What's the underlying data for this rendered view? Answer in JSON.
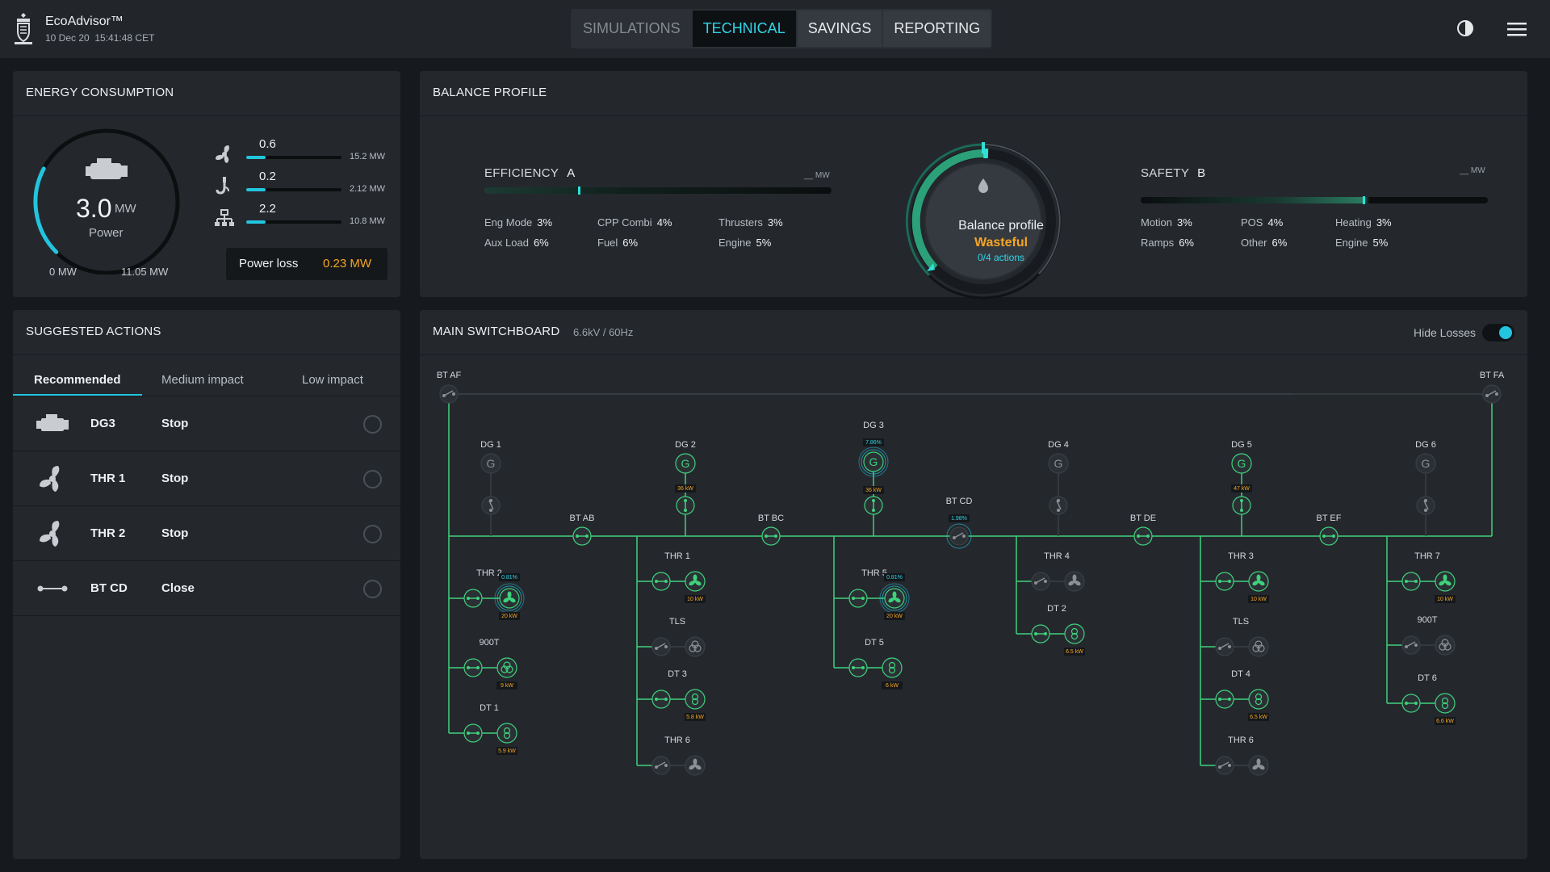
{
  "header": {
    "brand": "EcoAdvisor™",
    "date": "10 Dec 20",
    "time": "15:41:48 CET",
    "tabs": [
      "SIMULATIONS",
      "TECHNICAL",
      "SAVINGS",
      "REPORTING"
    ],
    "active_tab": "TECHNICAL"
  },
  "energy": {
    "title": "ENERGY CONSUMPTION",
    "power_value": "3.0",
    "power_unit": "MW",
    "power_label": "Power",
    "min_label": "0 MW",
    "max_label": "11.05 MW",
    "power_fraction": 0.27,
    "rows": [
      {
        "icon": "propeller-icon",
        "value": "0.6",
        "max": "15.2 MW",
        "fraction": 0.2
      },
      {
        "icon": "crane-hook-icon",
        "value": "0.2",
        "max": "2.12 MW",
        "fraction": 0.2
      },
      {
        "icon": "network-icon",
        "value": "2.2",
        "max": "10.8 MW",
        "fraction": 0.2
      }
    ],
    "power_loss_label": "Power loss",
    "power_loss_value": "0.23 MW"
  },
  "balance": {
    "title": "BALANCE PROFILE",
    "efficiency": {
      "label": "EFFICIENCY",
      "grade": "A",
      "unit": "__ MW",
      "level": 0.27,
      "items": [
        {
          "name": "Eng Mode",
          "value": "3%"
        },
        {
          "name": "CPP Combi",
          "value": "4%"
        },
        {
          "name": "Thrusters",
          "value": "3%"
        },
        {
          "name": "Aux Load",
          "value": "6%"
        },
        {
          "name": "Fuel",
          "value": "6%"
        },
        {
          "name": "Engine",
          "value": "5%"
        }
      ]
    },
    "safety": {
      "label": "SAFETY",
      "grade": "B",
      "unit": "__ MW",
      "level": 0.64,
      "items": [
        {
          "name": "Motion",
          "value": "3%"
        },
        {
          "name": "POS",
          "value": "4%"
        },
        {
          "name": "Heating",
          "value": "3%"
        },
        {
          "name": "Ramps",
          "value": "6%"
        },
        {
          "name": "Other",
          "value": "6%"
        },
        {
          "name": "Engine",
          "value": "5%"
        }
      ]
    },
    "center_title": "Balance profile",
    "center_status": "Wasteful",
    "center_actions": "0/4 actions"
  },
  "actions": {
    "title": "SUGGESTED ACTIONS",
    "tabs": [
      "Recommended",
      "Medium impact",
      "Low impact"
    ],
    "active_tab": "Recommended",
    "items": [
      {
        "icon": "engine-icon",
        "name": "DG3",
        "action": "Stop"
      },
      {
        "icon": "propeller-icon",
        "name": "THR 1",
        "action": "Stop"
      },
      {
        "icon": "propeller-icon",
        "name": "THR 2",
        "action": "Stop"
      },
      {
        "icon": "breaker-icon",
        "name": "BT CD",
        "action": "Close"
      }
    ]
  },
  "switchboard": {
    "title": "MAIN SWITCHBOARD",
    "subtitle": "6.6kV / 60Hz",
    "hide_losses_label": "Hide Losses",
    "hide_losses_on": true,
    "accent": "#3fd17c",
    "off_color": "#8a9096",
    "bus_ties": [
      {
        "name": "BT AF"
      },
      {
        "name": "BT FA"
      },
      {
        "name": "BT AB"
      },
      {
        "name": "BT BC"
      },
      {
        "name": "BT CD",
        "tag": "1.98%"
      },
      {
        "name": "BT DE"
      },
      {
        "name": "BT EF"
      }
    ],
    "generators": [
      {
        "name": "DG 1",
        "on": false
      },
      {
        "name": "DG 2",
        "on": true,
        "load": "36 kW"
      },
      {
        "name": "DG 3",
        "on": true,
        "tag": "7.86%",
        "load": "36 kW"
      },
      {
        "name": "DG 4",
        "on": false
      },
      {
        "name": "DG 5",
        "on": true,
        "load": "47 kW"
      },
      {
        "name": "DG 6",
        "on": false
      }
    ],
    "consumers": [
      {
        "name": "THR 2",
        "type": "thruster",
        "on": true,
        "tag": "0.81%",
        "load": "20 kW"
      },
      {
        "name": "900T",
        "type": "pump",
        "on": true,
        "load": "9 kW"
      },
      {
        "name": "DT 1",
        "type": "transformer",
        "on": true,
        "load": "5.9 kW"
      },
      {
        "name": "THR 1",
        "type": "thruster",
        "on": true,
        "load": "10 kW"
      },
      {
        "name": "TLS",
        "type": "pump",
        "on": false
      },
      {
        "name": "DT 3",
        "type": "transformer",
        "on": true,
        "load": "5.8 kW"
      },
      {
        "name": "THR 6",
        "type": "thruster",
        "on": false
      },
      {
        "name": "THR 5",
        "type": "thruster",
        "on": true,
        "tag": "0.81%",
        "load": "20 kW"
      },
      {
        "name": "DT 5",
        "type": "transformer",
        "on": true,
        "load": "6 kW"
      },
      {
        "name": "THR 4",
        "type": "thruster",
        "on": false
      },
      {
        "name": "DT 2",
        "type": "transformer",
        "on": true,
        "load": "6.5 kW"
      },
      {
        "name": "THR 3",
        "type": "thruster",
        "on": true,
        "load": "10 kW"
      },
      {
        "name": "TLS",
        "type": "pump",
        "on": false
      },
      {
        "name": "DT 4",
        "type": "transformer",
        "on": true,
        "load": "6.5 kW"
      },
      {
        "name": "THR 6",
        "type": "thruster",
        "on": false
      },
      {
        "name": "THR 7",
        "type": "thruster",
        "on": true,
        "load": "10 kW"
      },
      {
        "name": "900T",
        "type": "pump",
        "on": false
      },
      {
        "name": "DT 6",
        "type": "transformer",
        "on": true,
        "load": "6.6 kW"
      }
    ]
  }
}
